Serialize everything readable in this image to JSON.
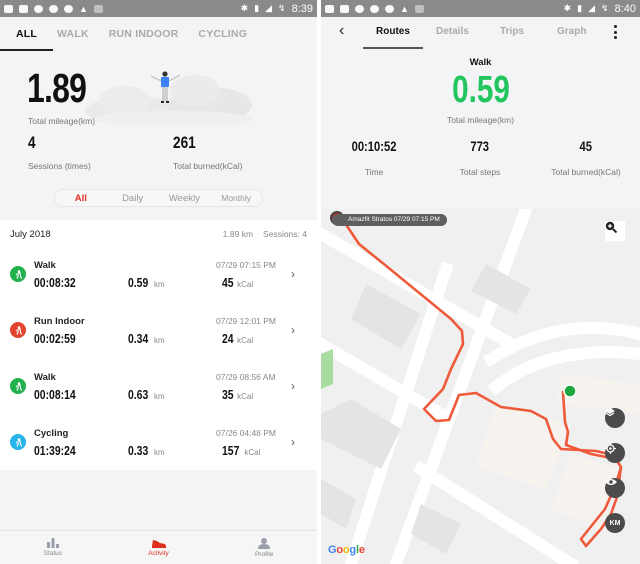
{
  "left": {
    "status_bar": {
      "time": "8:39"
    },
    "tabs": [
      {
        "label": "ALL",
        "active": true
      },
      {
        "label": "WALK",
        "active": false
      },
      {
        "label": "RUN INDOOR",
        "active": false
      },
      {
        "label": "CYCLING",
        "active": false
      }
    ],
    "summary": {
      "total_mileage": "1.89",
      "total_mileage_label": "Total mileage(km)",
      "sessions": "4",
      "sessions_label": "Sessions (times)",
      "burned": "261",
      "burned_label": "Total burned(kCal)"
    },
    "period_filter": [
      {
        "label": "All",
        "active": true
      },
      {
        "label": "Daily",
        "active": false
      },
      {
        "label": "Weekly",
        "active": false
      },
      {
        "label": "Monthly",
        "active": false
      }
    ],
    "list": {
      "month": "July 2018",
      "month_distance": "1.89 km",
      "month_sessions": "Sessions: 4",
      "items": [
        {
          "type": "Walk",
          "icon": "walk-icon",
          "color": "#22b14c",
          "duration": "00:08:32",
          "distance": "0.59",
          "distance_unit": "km",
          "datetime": "07/29 07:15 PM",
          "kcal": "45",
          "kcal_unit": "kCal"
        },
        {
          "type": "Run Indoor",
          "icon": "treadmill-icon",
          "color": "#e2452f",
          "duration": "00:02:59",
          "distance": "0.34",
          "distance_unit": "km",
          "datetime": "07/29 12:01 PM",
          "kcal": "24",
          "kcal_unit": "kCal"
        },
        {
          "type": "Walk",
          "icon": "walk-icon",
          "color": "#22b14c",
          "duration": "00:08:14",
          "distance": "0.63",
          "distance_unit": "km",
          "datetime": "07/29 08:56 AM",
          "kcal": "35",
          "kcal_unit": "kCal"
        },
        {
          "type": "Cycling",
          "icon": "bike-icon",
          "color": "#27b4e6",
          "duration": "01:39:24",
          "distance": "0.33",
          "distance_unit": "km",
          "datetime": "07/26 04:48 PM",
          "kcal": "157",
          "kcal_unit": "kCal"
        }
      ]
    },
    "bottom_nav": [
      {
        "label": "Status",
        "icon": "bar-chart-icon",
        "active": false
      },
      {
        "label": "Activity",
        "icon": "shoe-icon",
        "active": true
      },
      {
        "label": "Profile",
        "icon": "person-icon",
        "active": false
      }
    ]
  },
  "right": {
    "status_bar": {
      "time": "8:40"
    },
    "tabs": [
      {
        "label": "Routes",
        "active": true
      },
      {
        "label": "Details",
        "active": false
      },
      {
        "label": "Trips",
        "active": false
      },
      {
        "label": "Graph",
        "active": false
      }
    ],
    "activity_type": "Walk",
    "total_mileage": "0.59",
    "total_mileage_label": "Total mileage(km)",
    "stats": [
      {
        "value": "00:10:52",
        "label": "Time"
      },
      {
        "value": "773",
        "label": "Total steps"
      },
      {
        "value": "45",
        "label": "Total burned(kCal)"
      }
    ],
    "map": {
      "start_label": "Amazfit Stratos  07/29 07:15 PM",
      "unit_button": "KM",
      "attribution": "Google",
      "route_color": "#ee5a3a",
      "end_marker_color": "#1fa83f"
    },
    "colors": {
      "accent_red": "#e03020",
      "accent_green": "#22c55e"
    }
  }
}
